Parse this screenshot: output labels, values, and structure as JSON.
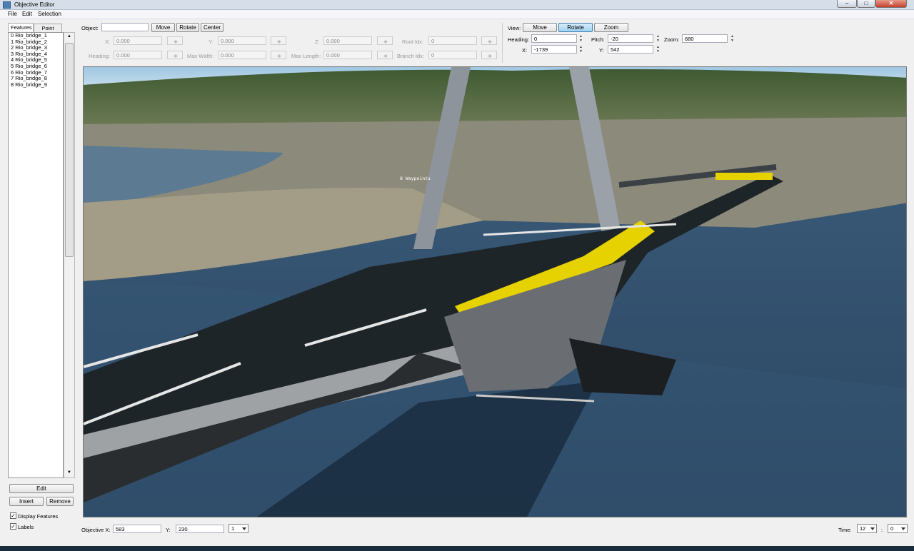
{
  "window": {
    "title": "Objective Editor"
  },
  "menu": [
    "File",
    "Edit",
    "Selection"
  ],
  "tabs": [
    "Features",
    "Point Data"
  ],
  "features": [
    "0 Rio_bridge_1",
    "1 Rio_bridge_2",
    "2 Rio_bridge_3",
    "3 Rio_bridge_4",
    "4 Rio_bridge_5",
    "5 Rio_bridge_6",
    "6 Rio_bridge_7",
    "7 Rio_bridge_8",
    "8 Rio_bridge_9"
  ],
  "left_buttons": {
    "edit": "Edit",
    "insert": "Insert",
    "remove": "Remove"
  },
  "checkboxes": {
    "display_features": "Display Features",
    "labels": "Labels"
  },
  "object": {
    "label": "Object:",
    "value": "",
    "move": "Move",
    "rotate": "Rotate",
    "center": "Center",
    "x_label": "X:",
    "x": "0.000",
    "y_label": "Y:",
    "y": "0.000",
    "z_label": "Z:",
    "z": "0.000",
    "root_label": "Root Idx:",
    "root": "0",
    "heading_label": "Heading:",
    "heading": "0.000",
    "maxw_label": "Max Width:",
    "maxw": "0.000",
    "maxl_label": "Max Length:",
    "maxl": "0.000",
    "branch_label": "Branch Idx:",
    "branch": "0"
  },
  "view": {
    "label": "View:",
    "move": "Move",
    "rotate": "Rotate",
    "zoom": "Zoom",
    "heading_label": "Heading:",
    "heading": "0",
    "pitch_label": "Pitch:",
    "pitch": "-20",
    "zoom_label": "Zoom:",
    "zoom_value": "680",
    "x_label": "X:",
    "x": "-1739",
    "y_label": "Y:",
    "y": "542"
  },
  "viewport": {
    "label": "8 Waypoints"
  },
  "bottom": {
    "objx_label": "Objective X:",
    "objx": "583",
    "y_label": "Y:",
    "y": "230",
    "combo": "1",
    "time_label": "Time:",
    "hour": "12",
    "sep": ":",
    "minute": "0"
  },
  "colors": {
    "accent": "#3c7fb1",
    "water": "#2d4a63",
    "deck_yellow": "#e6d200"
  }
}
